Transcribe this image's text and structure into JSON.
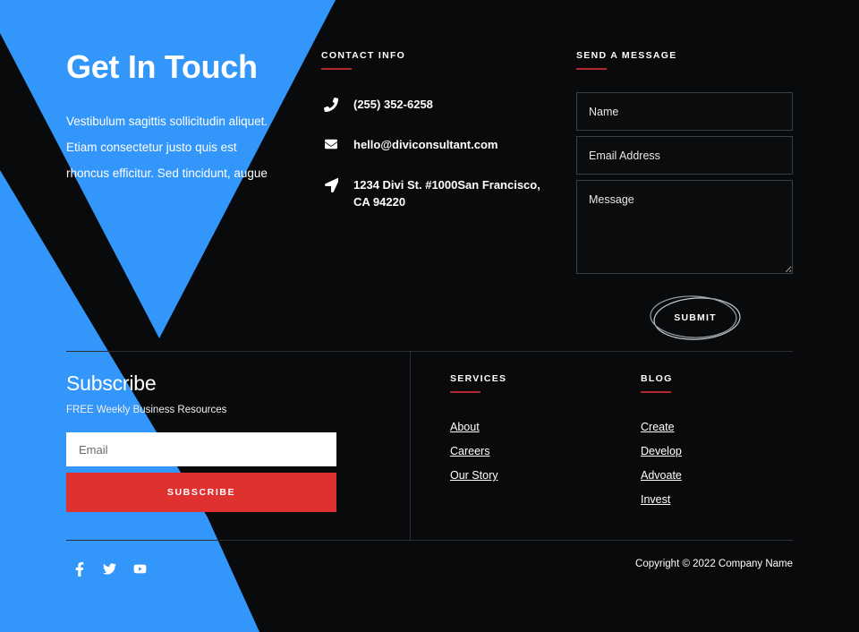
{
  "hero": {
    "title": "Get In Touch",
    "paragraph": "Vestibulum sagittis sollicitudin aliquet. Etiam consectetur justo quis est rhoncus efficitur. Sed tincidunt, augue"
  },
  "contact": {
    "heading": "CONTACT INFO",
    "items": [
      {
        "icon": "phone-icon",
        "text": "(255) 352-6258"
      },
      {
        "icon": "envelope-icon",
        "text": "hello@diviconsultant.com"
      },
      {
        "icon": "location-arrow-icon",
        "text": "1234 Divi St. #1000San Francisco, CA 94220"
      }
    ]
  },
  "message_form": {
    "heading": "SEND A MESSAGE",
    "name_placeholder": "Name",
    "name_value": "",
    "email_placeholder": "Email Address",
    "email_value": "",
    "message_placeholder": "Message",
    "message_value": "",
    "submit_label": "SUBMIT"
  },
  "subscribe": {
    "title": "Subscribe",
    "subtitle": "FREE Weekly Business Resources",
    "email_placeholder": "Email",
    "email_value": "",
    "button_label": "SUBSCRIBE"
  },
  "services": {
    "heading": "SERVICES",
    "links": [
      "About",
      "Careers",
      "Our Story"
    ]
  },
  "blog": {
    "heading": "BLOG",
    "links": [
      "Create",
      "Develop",
      "Advoate",
      "Invest"
    ]
  },
  "footer": {
    "social": [
      "facebook-icon",
      "twitter-icon",
      "youtube-icon"
    ],
    "copyright": "Copyright © 2022 Company Name"
  },
  "colors": {
    "accent_blue": "#3396fb",
    "accent_red": "#e03131",
    "rule_red": "#b3282d",
    "background": "#080a0c",
    "text": "#ffffff"
  }
}
